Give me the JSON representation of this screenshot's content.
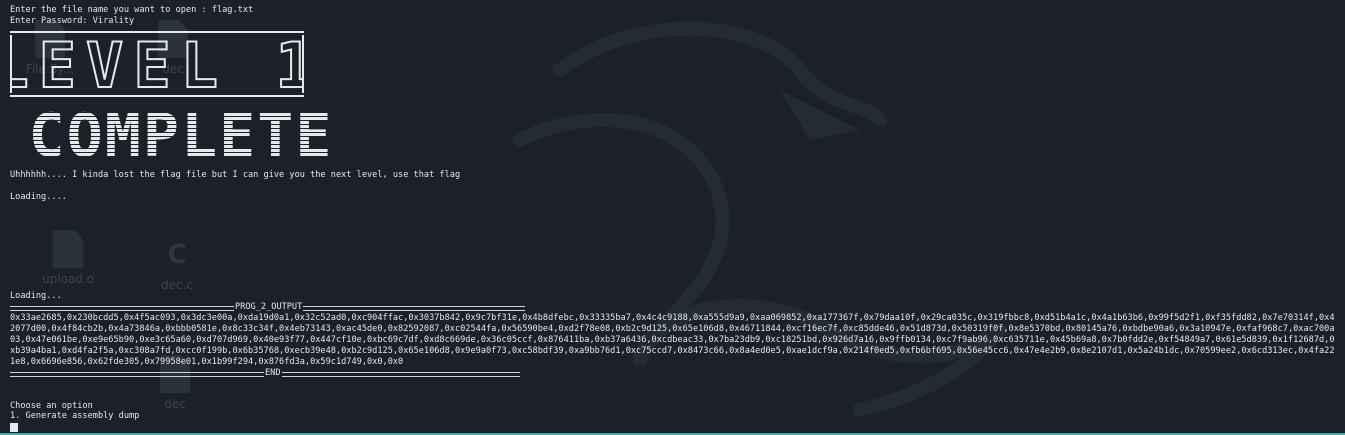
{
  "desktop": {
    "icons": [
      {
        "label": "File Sy...",
        "kind": "file"
      },
      {
        "label": "dec",
        "kind": "file"
      },
      {
        "label": "upload.o",
        "kind": "file"
      },
      {
        "label": "dec.c",
        "kind": "cfile"
      },
      {
        "label": "dec",
        "kind": "file"
      }
    ]
  },
  "terminal": {
    "prompt_file": "Enter the file name you want to open : flag.txt",
    "prompt_password": "Enter Password: Virality",
    "banner_line1": "LEVEL 1",
    "banner_line2": "COMPLETE",
    "message": "Uhhhhhh.... I kinda lost the flag file but I can give you the next level, use that flag",
    "loading1": "Loading....",
    "loading2": "Loading...",
    "output_header": "PROG_2_OUTPUT",
    "output_body": "0x33ae2685,0x230bcdd5,0x4f5ac093,0x3dc3e00a,0xda19d0a1,0x32c52ad0,0xc904ffac,0x3037b842,0x9c7bf31e,0x4b8dfebc,0x33335ba7,0x4c4c9188,0xa555d9a9,0xaa069852,0xa177367f,0x79daa10f,0x29ca035c,0x319fbbc8,0xd51b4a1c,0x4a1b63b6,0x99f5d2f1,0xf35fdd82,0x7e70314f,0x42077d00,0x4f84cb2b,0x4a73846a,0xbbb0581e,0x8c33c34f,0x4eb73143,0xac45de0,0x82592087,0xc02544fa,0x56590be4,0xd2f78e08,0xb2c9d125,0x65e106d8,0x46711844,0xcf16ec7f,0xc85dde46,0x51d873d,0x50319f0f,0x8e5370bd,0x80145a76,0xbdbe90a6,0x3a10947e,0xfaf968c7,0xac700a03,0x47e061be,0xe9e65b90,0xe3c65a60,0xd707d969,0x40e93f77,0x447cf10e,0xbc69c7df,0xd8c669de,0x36c05ccf,0x876411ba,0xb37a6436,0xcdbeac33,0x7ba23db9,0xc18251bd,0x926d7a16,0x9ffb0134,0xc7f9ab96,0xc635711e,0x45b69a8,0x7b0fdd2e,0xf54849a7,0x61e5d839,0x1f12687d,0xb39a4ba1,0xd4fa2f5a,0xc308a7fd,0xcc0f199b,0x6b35768,0xecb39e48,0xb2c9d125,0x65e106d8,0x9e9a0f73,0xc58bdf39,0xa9bb76d1,0xc75ccd7,0x8473c66,0x8a4ed0e5,0xae1dcf9a,0x214f0ed5,0xfb6bf695,0x56e45cc6,0x47e4e2b9,0x8e2107d1,0x5a24b1dc,0x70599ee2,0x6cd313ec,0x4fa221e8,0x6696e856,0x62fde305,0x79958e01,0x1b99f294,0x876fd3a,0x59c1d749,0x0,0x0",
    "output_footer": "END",
    "menu_title": "Choose an option",
    "menu_option1": "1. Generate assembly dump",
    "input_prompt": "-"
  }
}
